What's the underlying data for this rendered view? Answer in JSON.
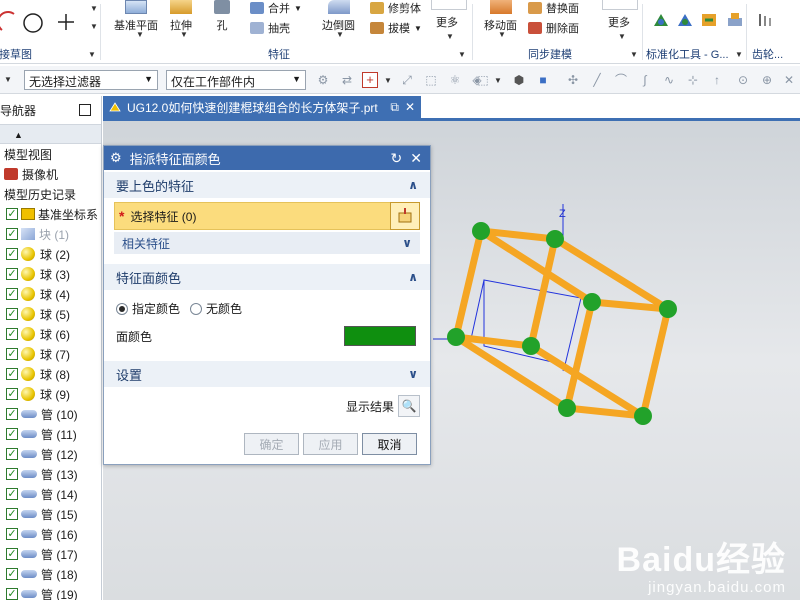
{
  "ribbon": {
    "groups": [
      {
        "label": "直接草图"
      },
      {
        "label": "特征"
      },
      {
        "label": "同步建模"
      },
      {
        "label": "标准化工具 - G..."
      },
      {
        "label": "齿轮..."
      }
    ],
    "large_buttons": [
      "基准平面",
      "拉伸",
      "孔",
      "边倒圆",
      "更多",
      "移动面",
      "更多"
    ],
    "small_buttons": [
      "合并",
      "抽壳",
      "修剪体",
      "拔模",
      "替换面",
      "删除面"
    ]
  },
  "filterbar": {
    "filter_select": "无选择过滤器",
    "scope_select": "仅在工作部件内"
  },
  "navigator": {
    "title": "部件导航器",
    "items": [
      {
        "label": "模型视图",
        "icon": "none",
        "checked": false,
        "dim": false
      },
      {
        "label": "摄像机",
        "icon": "camera",
        "checked": false,
        "dim": false
      },
      {
        "label": "模型历史记录",
        "icon": "none",
        "checked": false,
        "dim": false
      },
      {
        "label": "基准坐标系",
        "icon": "csys",
        "checked": true,
        "dim": false
      },
      {
        "label": "块 (1)",
        "icon": "block",
        "checked": true,
        "dim": true
      },
      {
        "label": "球 (2)",
        "icon": "sphere",
        "checked": true,
        "dim": false
      },
      {
        "label": "球 (3)",
        "icon": "sphere",
        "checked": true,
        "dim": false
      },
      {
        "label": "球 (4)",
        "icon": "sphere",
        "checked": true,
        "dim": false
      },
      {
        "label": "球 (5)",
        "icon": "sphere",
        "checked": true,
        "dim": false
      },
      {
        "label": "球 (6)",
        "icon": "sphere",
        "checked": true,
        "dim": false
      },
      {
        "label": "球 (7)",
        "icon": "sphere",
        "checked": true,
        "dim": false
      },
      {
        "label": "球 (8)",
        "icon": "sphere",
        "checked": true,
        "dim": false
      },
      {
        "label": "球 (9)",
        "icon": "sphere",
        "checked": true,
        "dim": false
      },
      {
        "label": "管 (10)",
        "icon": "tube",
        "checked": true,
        "dim": false
      },
      {
        "label": "管 (11)",
        "icon": "tube",
        "checked": true,
        "dim": false
      },
      {
        "label": "管 (12)",
        "icon": "tube",
        "checked": true,
        "dim": false
      },
      {
        "label": "管 (13)",
        "icon": "tube",
        "checked": true,
        "dim": false
      },
      {
        "label": "管 (14)",
        "icon": "tube",
        "checked": true,
        "dim": false
      },
      {
        "label": "管 (15)",
        "icon": "tube",
        "checked": true,
        "dim": false
      },
      {
        "label": "管 (16)",
        "icon": "tube",
        "checked": true,
        "dim": false
      },
      {
        "label": "管 (17)",
        "icon": "tube",
        "checked": true,
        "dim": false
      },
      {
        "label": "管 (18)",
        "icon": "tube",
        "checked": true,
        "dim": false
      },
      {
        "label": "管 (19)",
        "icon": "tube",
        "checked": true,
        "dim": false
      }
    ]
  },
  "document_tab": {
    "title": "UG12.0如何快速创建棍球组合的长方体架子.prt"
  },
  "viewport": {
    "axis_label": "Z"
  },
  "dialog": {
    "title": "指派特征面颜色",
    "section_features": "要上色的特征",
    "select_feature": "选择特征 (0)",
    "related_features": "相关特征",
    "section_color": "特征面颜色",
    "radio_specify": "指定颜色",
    "radio_none": "无颜色",
    "face_color_label": "面颜色",
    "face_color": "#0f8f0f",
    "section_settings": "设置",
    "show_result": "显示结果",
    "ok": "确定",
    "apply": "应用",
    "cancel": "取消"
  },
  "watermark": {
    "logo": "Baidu经验",
    "url": "jingyan.baidu.com"
  },
  "colors": {
    "title_bar": "#3d6aad",
    "tube": "#f5a623",
    "ball": "#22a22a",
    "highlight": "#fbdc7d"
  }
}
